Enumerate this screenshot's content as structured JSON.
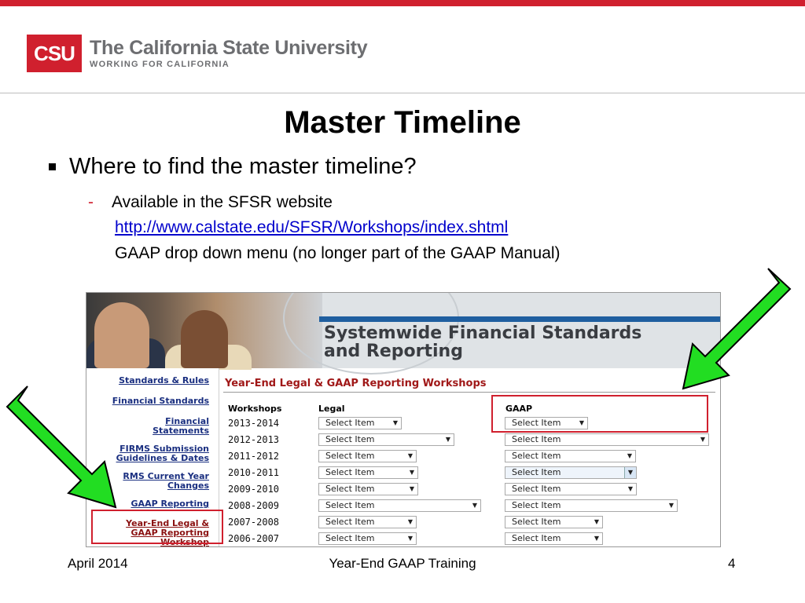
{
  "colors": {
    "accent": "#d0202e",
    "link": "#0000cc",
    "arrow": "#22dd22"
  },
  "logo": {
    "mark": "CSU",
    "title": "The California State University",
    "subtitle": "WORKING FOR CALIFORNIA"
  },
  "slide": {
    "title": "Master Timeline",
    "bullet": "Where to find the master timeline?",
    "sub_dash": "-",
    "sub_text": "Available in the SFSR website",
    "link": "http://www.calstate.edu/SFSR/Workshops/index.shtml",
    "sub_text2": "GAAP drop down menu (no longer part of the GAAP Manual)"
  },
  "screenshot": {
    "banner_title_1": "Systemwide Financial Standards",
    "banner_title_2": "and Reporting",
    "nav": {
      "standards": "Standards & Rules",
      "financial_standards": "Financial Standards",
      "financial_statements_1": "Financial",
      "financial_statements_2": "Statements",
      "firms_1": "FIRMS Submission",
      "firms_2": "Guidelines & Dates",
      "current_1": "RMS Current Year",
      "current_2": "Changes",
      "gaap_reporting": "GAAP Reporting",
      "yearend_1": "Year-End Legal &",
      "yearend_2": "GAAP Reporting",
      "yearend_3": "Workshop"
    },
    "section_title": "Year-End Legal & GAAP Reporting Workshops",
    "col_workshops": "Workshops",
    "col_legal": "Legal",
    "col_gaap": "GAAP",
    "select_placeholder": "Select Item",
    "rows": [
      {
        "year": "2013-2014"
      },
      {
        "year": "2012-2013"
      },
      {
        "year": "2011-2012"
      },
      {
        "year": "2010-2011"
      },
      {
        "year": "2009-2010"
      },
      {
        "year": "2008-2009"
      },
      {
        "year": "2007-2008"
      },
      {
        "year": "2006-2007"
      }
    ]
  },
  "footer": {
    "date": "April 2014",
    "center": "Year-End GAAP Training",
    "page": "4"
  }
}
